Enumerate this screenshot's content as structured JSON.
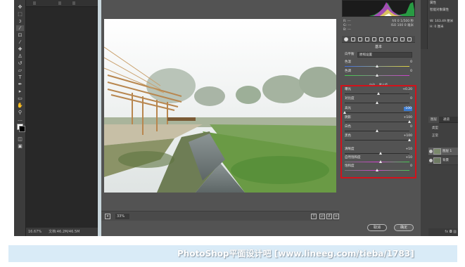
{
  "document": {
    "status_zoom": "16.67%",
    "status_doc": "文档:46.2M/46.5M"
  },
  "acr": {
    "zoom": "33%",
    "histogram_info": {
      "r": "R: ---",
      "g": "G: ---",
      "b": "B: ---",
      "exposure": "f/0 0   1/500 秒",
      "iso": "ISO 100   0 毫米"
    },
    "panel_title": "基本",
    "white_balance_label": "白平衡",
    "white_balance_value": "原照设置",
    "temperature": {
      "label": "色温",
      "value": "0",
      "pos": 0.5
    },
    "tint": {
      "label": "色调",
      "value": "0",
      "pos": 0.5
    },
    "auto_tabs": [
      "自动",
      "默认值"
    ],
    "sliders": [
      {
        "name": "exposure",
        "label": "曝光",
        "value": "+0.20",
        "pos": 0.52,
        "highlight": false
      },
      {
        "name": "contrast",
        "label": "对比度",
        "value": "0",
        "pos": 0.5,
        "highlight": false
      },
      {
        "name": "highlights",
        "label": "高光",
        "value": "-100",
        "pos": 0.0,
        "highlight": true
      },
      {
        "name": "shadows",
        "label": "阴影",
        "value": "+100",
        "pos": 1.0,
        "highlight": false
      },
      {
        "name": "whites",
        "label": "白色",
        "value": "0",
        "pos": 0.5,
        "highlight": false
      },
      {
        "name": "blacks",
        "label": "黑色",
        "value": "+100",
        "pos": 1.0,
        "highlight": false
      },
      {
        "name": "clarity",
        "label": "清晰度",
        "value": "+10",
        "pos": 0.55,
        "highlight": false
      },
      {
        "name": "vibrance",
        "label": "自然饱和度",
        "value": "+10",
        "pos": 0.55,
        "highlight": false
      },
      {
        "name": "saturation",
        "label": "饱和度",
        "value": "0",
        "pos": 0.5,
        "highlight": false
      }
    ],
    "cancel_label": "取消",
    "ok_label": "确定"
  },
  "right_panel": {
    "props_title": "属性",
    "props_sub": "智能对象属性",
    "props_dims": "W: 163.49 厘米",
    "props_dims2": "H: 0 厘米",
    "tabs": [
      "图层",
      "通道"
    ],
    "kind_label": "类型",
    "mode_label": "正常",
    "layers": [
      {
        "name": "图层 1",
        "selected": true
      },
      {
        "name": "背景",
        "selected": false
      }
    ],
    "bottom_icons": "fx ◘ ▥"
  },
  "watermark": "PhotoShop平面设计吧 [www.lineeg.com/tieba/1783]",
  "colors": {
    "highlight_box": "#d3121b",
    "selection_blue": "#3b7bd1",
    "frame_bg": "#2b2b2b"
  }
}
